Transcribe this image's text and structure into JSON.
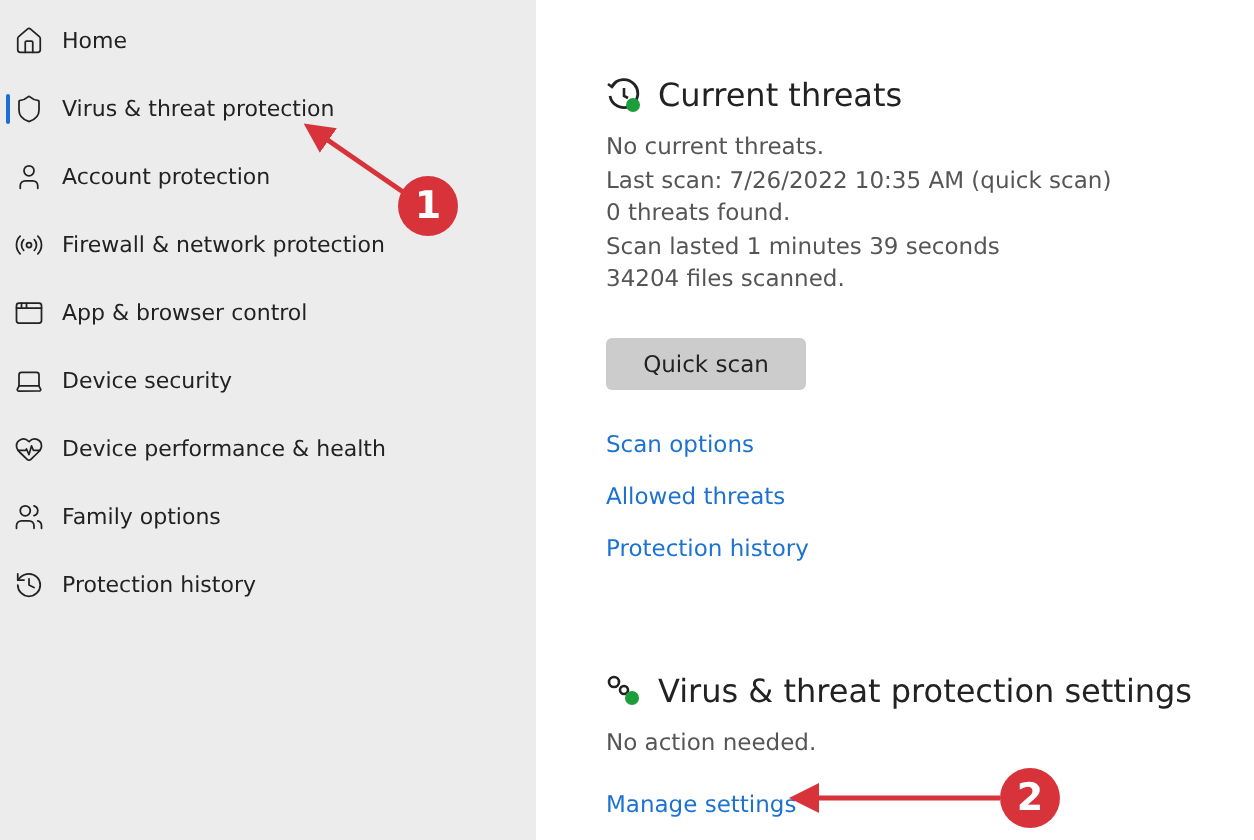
{
  "sidebar": {
    "items": [
      {
        "label": "Home",
        "selected": false
      },
      {
        "label": "Virus & threat protection",
        "selected": true
      },
      {
        "label": "Account protection",
        "selected": false
      },
      {
        "label": "Firewall & network protection",
        "selected": false
      },
      {
        "label": "App & browser control",
        "selected": false
      },
      {
        "label": "Device security",
        "selected": false
      },
      {
        "label": "Device performance & health",
        "selected": false
      },
      {
        "label": "Family options",
        "selected": false
      },
      {
        "label": "Protection history",
        "selected": false
      }
    ]
  },
  "sections": [
    {
      "kind": "threats",
      "title": "Current threats",
      "lines": [
        "No current threats.",
        "Last scan: 7/26/2022 10:35 AM (quick scan)",
        "0 threats found.",
        "Scan lasted 1 minutes 39 seconds",
        "34204 files scanned."
      ],
      "button": "Quick scan",
      "links": [
        "Scan options",
        "Allowed threats",
        "Protection history"
      ]
    },
    {
      "kind": "settings",
      "title": "Virus & threat protection settings",
      "lines": [
        "No action needed."
      ],
      "links": [
        "Manage settings"
      ]
    }
  ],
  "annotations": [
    {
      "number": "1"
    },
    {
      "number": "2"
    }
  ]
}
